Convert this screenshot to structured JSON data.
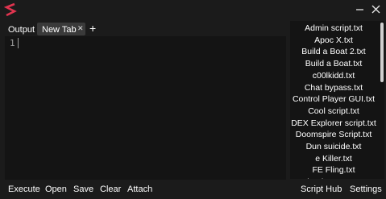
{
  "app": {
    "logo_icon": "s-logo-icon",
    "accent_color": "#e0344f"
  },
  "titlebar": {
    "minimize_icon": "minimize-icon",
    "close_icon": "close-icon"
  },
  "tabs": {
    "output_label": "Output",
    "active_tab_label": "New Tab",
    "close_icon": "close-icon",
    "add_icon": "plus-icon"
  },
  "editor": {
    "line_numbers": [
      "1"
    ]
  },
  "scripts": [
    "Admin script.txt",
    "Apoc X.txt",
    "Build a Boat 2.txt",
    "Build a Boat.txt",
    "c00lkidd.txt",
    "Chat bypass.txt",
    "Control Player GUI.txt",
    "Cool script.txt",
    "DEX Explorer script.txt",
    "Doomspire Script.txt",
    "Dun suicide.txt",
    "e Killer.txt",
    "FE Fling.txt",
    "Flood Escape.txt"
  ],
  "toolbar": {
    "execute": "Execute",
    "open": "Open",
    "save": "Save",
    "clear": "Clear",
    "attach": "Attach",
    "script_hub": "Script Hub",
    "settings": "Settings"
  }
}
